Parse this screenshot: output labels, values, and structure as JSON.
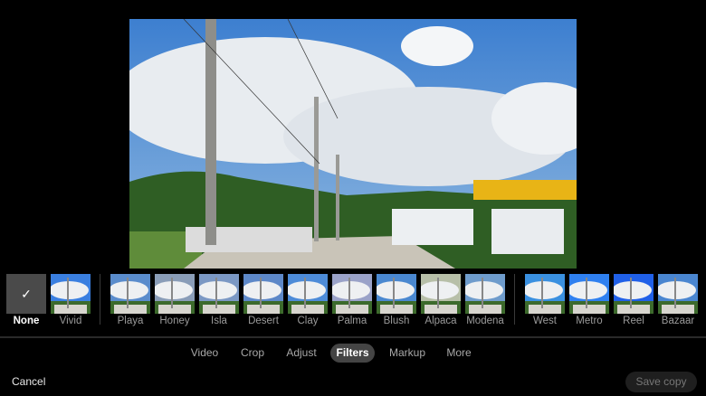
{
  "filters": {
    "selected": "None",
    "groups": [
      [
        "None",
        "Vivid"
      ],
      [
        "Playa",
        "Honey",
        "Isla",
        "Desert",
        "Clay",
        "Palma",
        "Blush",
        "Alpaca",
        "Modena"
      ],
      [
        "West",
        "Metro",
        "Reel",
        "Bazaar"
      ]
    ]
  },
  "tabs": [
    "Video",
    "Crop",
    "Adjust",
    "Filters",
    "Markup",
    "More"
  ],
  "active_tab": "Filters",
  "footer": {
    "cancel": "Cancel",
    "save": "Save copy"
  },
  "icons": {
    "selected": "checkmark-icon"
  }
}
